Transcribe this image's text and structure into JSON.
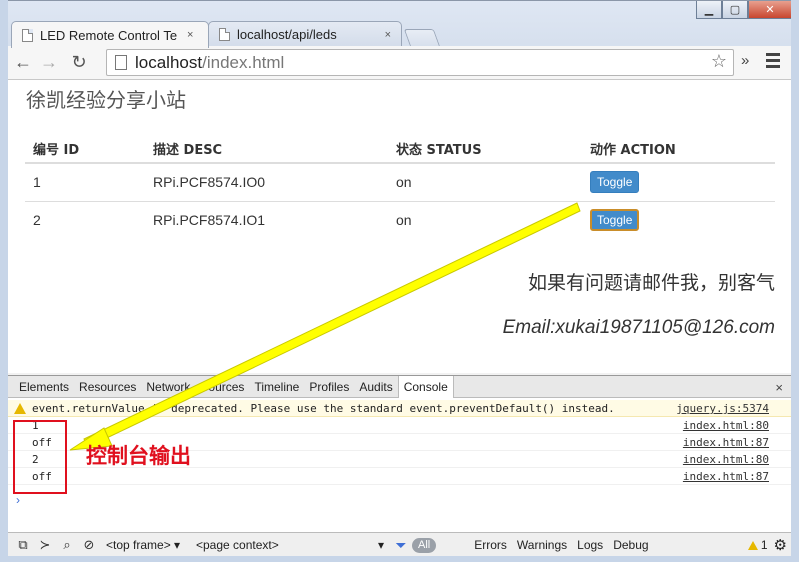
{
  "window": {
    "controls": {
      "minimize": "▁",
      "maximize": "▢",
      "close": "✕"
    }
  },
  "tabs": [
    {
      "label": "LED Remote Control Te",
      "close": "×",
      "active": true
    },
    {
      "label": "localhost/api/leds",
      "close": "×",
      "active": false
    }
  ],
  "toolbar": {
    "back": "←",
    "forward": "→",
    "reload": "↻",
    "url_host": "localhost",
    "url_path": "/index.html",
    "star": "☆",
    "extensions": "»"
  },
  "page": {
    "site_title": "徐凯经验分享小站",
    "table": {
      "headers": [
        "编号 ID",
        "描述 DESC",
        "状态 STATUS",
        "动作 ACTION"
      ],
      "rows": [
        {
          "id": "1",
          "desc": "RPi.PCF8574.IO0",
          "status": "on",
          "action": "Toggle"
        },
        {
          "id": "2",
          "desc": "RPi.PCF8574.IO1",
          "status": "on",
          "action": "Toggle"
        }
      ]
    },
    "contact": "如果有问题请邮件我，别客气",
    "email": "Email:xukai19871105@126.com"
  },
  "devtools": {
    "tabs": [
      "Elements",
      "Resources",
      "Network",
      "Sources",
      "Timeline",
      "Profiles",
      "Audits",
      "Console"
    ],
    "active_tab": "Console",
    "close": "×",
    "console": [
      {
        "type": "warning",
        "text": "event.returnValue is deprecated. Please use the standard event.preventDefault() instead.",
        "source": "jquery.js:5374"
      },
      {
        "type": "log",
        "text": "1",
        "source": "index.html:80"
      },
      {
        "type": "log",
        "text": "off",
        "source": "index.html:87"
      },
      {
        "type": "log",
        "text": "2",
        "source": "index.html:80"
      },
      {
        "type": "log",
        "text": "off",
        "source": "index.html:87"
      }
    ],
    "prompt": "›",
    "bottom": {
      "frame_select": "<top frame>",
      "context_select": "<page context>",
      "levels": [
        "All",
        "Errors",
        "Warnings",
        "Logs",
        "Debug"
      ],
      "warning_count": "1"
    }
  },
  "annotation": {
    "label": "控制台输出",
    "color": "#e0101e",
    "arrow_color": "#ffff00"
  },
  "colors": {
    "button": "#428bca",
    "focus_border": "#c98d2a"
  }
}
